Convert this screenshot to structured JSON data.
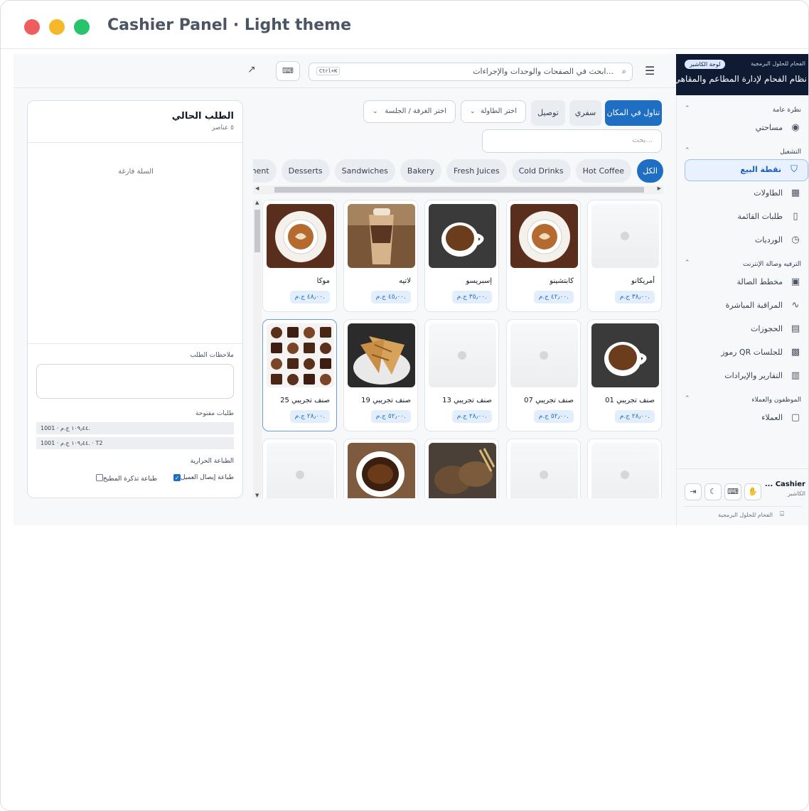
{
  "window": {
    "title": "Cashier Panel · Light theme"
  },
  "brand": {
    "subtitle": "الفحام للحلول البرمجية",
    "badge": "لوحة الكاشير",
    "name": "نظام الفحام لإدارة المطاعم والمقاهي"
  },
  "sidebar": {
    "groups": [
      {
        "label": "نظرة عامة",
        "items": [
          {
            "label": "مساحتي",
            "icon": "user-circle-icon"
          }
        ]
      },
      {
        "label": "التشغيل",
        "items": [
          {
            "label": "نقطة البيع",
            "icon": "cart-icon",
            "active": true
          },
          {
            "label": "الطاولات",
            "icon": "grid-icon"
          },
          {
            "label": "طلبات القائمة",
            "icon": "tablet-icon"
          },
          {
            "label": "الورديات",
            "icon": "clock-icon"
          }
        ]
      },
      {
        "label": "الترفيه وصالة الإنترنت",
        "items": [
          {
            "label": "مخطط الصالة",
            "icon": "layout-icon"
          },
          {
            "label": "المراقبة المباشرة",
            "icon": "pulse-icon"
          },
          {
            "label": "الحجوزات",
            "icon": "calendar-icon"
          },
          {
            "label": "رموز QR للجلسات",
            "icon": "qr-icon"
          },
          {
            "label": "التقارير والإيرادات",
            "icon": "bar-chart-icon"
          }
        ]
      },
      {
        "label": "الموظفون والعملاء",
        "items": [
          {
            "label": "العملاء",
            "icon": "contact-icon"
          }
        ]
      }
    ],
    "user": {
      "name": "... Cashier",
      "role": "الكاشير"
    },
    "credit": "الفحام للحلول البرمجية"
  },
  "topbar": {
    "search_placeholder": "ابحث في الصفحات والوحدات والإجراءات...",
    "shortcut": "Ctrl+K"
  },
  "order_modes": {
    "dine_in": "تناول في المكان",
    "safari": "سفري",
    "delivery": "توصيل"
  },
  "selects": {
    "table": "اختر الطاولة",
    "room": "اختر الغرفة / الجلسة"
  },
  "product_search": {
    "placeholder": "بحث..."
  },
  "categories": [
    "الكل",
    "Hot Coffee",
    "Cold Drinks",
    "Fresh Juices",
    "Bakery",
    "Sandwiches",
    "Desserts",
    "Entertainment"
  ],
  "products": [
    {
      "name": "أمريكانو",
      "price": "٣٨٫٠٠ ج.م.",
      "image": "placeholder"
    },
    {
      "name": "كابتشينو",
      "price": "٤٢٫٠٠ ج.م.",
      "image": "latte-art"
    },
    {
      "name": "إسبريسو",
      "price": "٣٥٫٠٠ ج.م.",
      "image": "black-coffee"
    },
    {
      "name": "لاتيه",
      "price": "٤٥٫٠٠ ج.م.",
      "image": "iced-latte"
    },
    {
      "name": "موكا",
      "price": "٤٨٫٠٠ ج.م.",
      "image": "latte-art"
    },
    {
      "name": "صنف تجريبي 01",
      "price": "٢٨٫٠٠ ج.م.",
      "image": "black-coffee"
    },
    {
      "name": "صنف تجريبي 07",
      "price": "٥٢٫٠٠ ج.م.",
      "image": "placeholder"
    },
    {
      "name": "صنف تجريبي 13",
      "price": "٢٨٫٠٠ ج.م.",
      "image": "placeholder"
    },
    {
      "name": "صنف تجريبي 19",
      "price": "٥٢٫٠٠ ج.م.",
      "image": "sandwich"
    },
    {
      "name": "صنف تجريبي 25",
      "price": "٢٨٫٠٠ ج.م.",
      "image": "chocolates",
      "selected": true
    },
    {
      "name": "",
      "price": "",
      "image": "placeholder"
    },
    {
      "name": "",
      "price": "",
      "image": "placeholder"
    },
    {
      "name": "",
      "price": "",
      "image": "bread"
    },
    {
      "name": "",
      "price": "",
      "image": "coffee-cup"
    },
    {
      "name": "",
      "price": "",
      "image": "placeholder"
    }
  ],
  "order": {
    "title": "الطلب الحالي",
    "count": "٥ عناصر",
    "empty": "السلة فارغة",
    "notes_label": "ملاحظات الطلب",
    "open_orders_label": "طلبات مفتوحة",
    "open_orders": [
      "1001 · ١٠٩٫٤٤ ج.م.",
      "1001 · ١٠٩٫٤٤ ج.م. · T2"
    ],
    "printer_label": "الطباعة الحرارية",
    "print_receipt": "طباعة إيصال العميل",
    "print_kitchen": "طباعة تذكرة المطبخ",
    "print_receipt_checked": true,
    "print_kitchen_checked": false
  },
  "colors": {
    "accent": "#1e6fc4",
    "brand_bg": "#0f1b33",
    "active_bg": "#e8f1fd",
    "price_bg": "#e2eefb"
  }
}
